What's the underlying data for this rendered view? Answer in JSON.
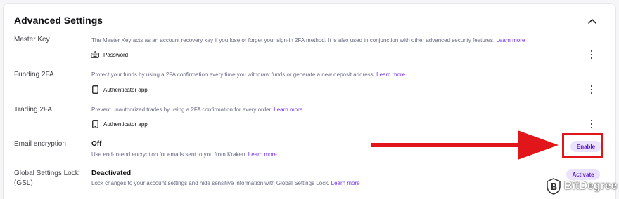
{
  "section": {
    "title": "Advanced Settings"
  },
  "rows": {
    "master_key": {
      "label": "Master Key",
      "description": "The Master Key acts as an account recovery key if you lose or forget your sign-in 2FA method. It is also used in conjunction with other advanced security features.",
      "learn_more": "Learn more",
      "method_icon": "keyboard-icon",
      "method": "Password"
    },
    "funding_2fa": {
      "label": "Funding 2FA",
      "description": "Protect your funds by using a 2FA confirmation every time you withdraw funds or generate a new deposit address.",
      "learn_more": "Learn more",
      "method_icon": "phone-icon",
      "method": "Authenticator app"
    },
    "trading_2fa": {
      "label": "Trading 2FA",
      "description": "Prevent unauthorized trades by using a 2FA confirmation for every order.",
      "learn_more": "Learn more",
      "method_icon": "phone-icon",
      "method": "Authenticator app"
    },
    "email_encryption": {
      "label": "Email encryption",
      "status": "Off",
      "description": "Use end-to-end encryption for emails sent to you from Kraken.",
      "learn_more": "Learn more",
      "button": "Enable"
    },
    "gsl": {
      "label_line1": "Global Settings Lock",
      "label_line2": "(GSL)",
      "status": "Deactivated",
      "description": "Lock changes to your account settings and hide sensitive information with Global Settings Lock.",
      "learn_more": "Learn more",
      "button": "Activate"
    }
  },
  "annotation": {
    "arrow_color": "#e0161b",
    "box_color": "#e0161b"
  },
  "watermark": {
    "text": "BitDegree"
  },
  "colors": {
    "accent": "#7132f5",
    "button_bg": "#ebe2fd",
    "button_text": "#5b1ecf"
  }
}
